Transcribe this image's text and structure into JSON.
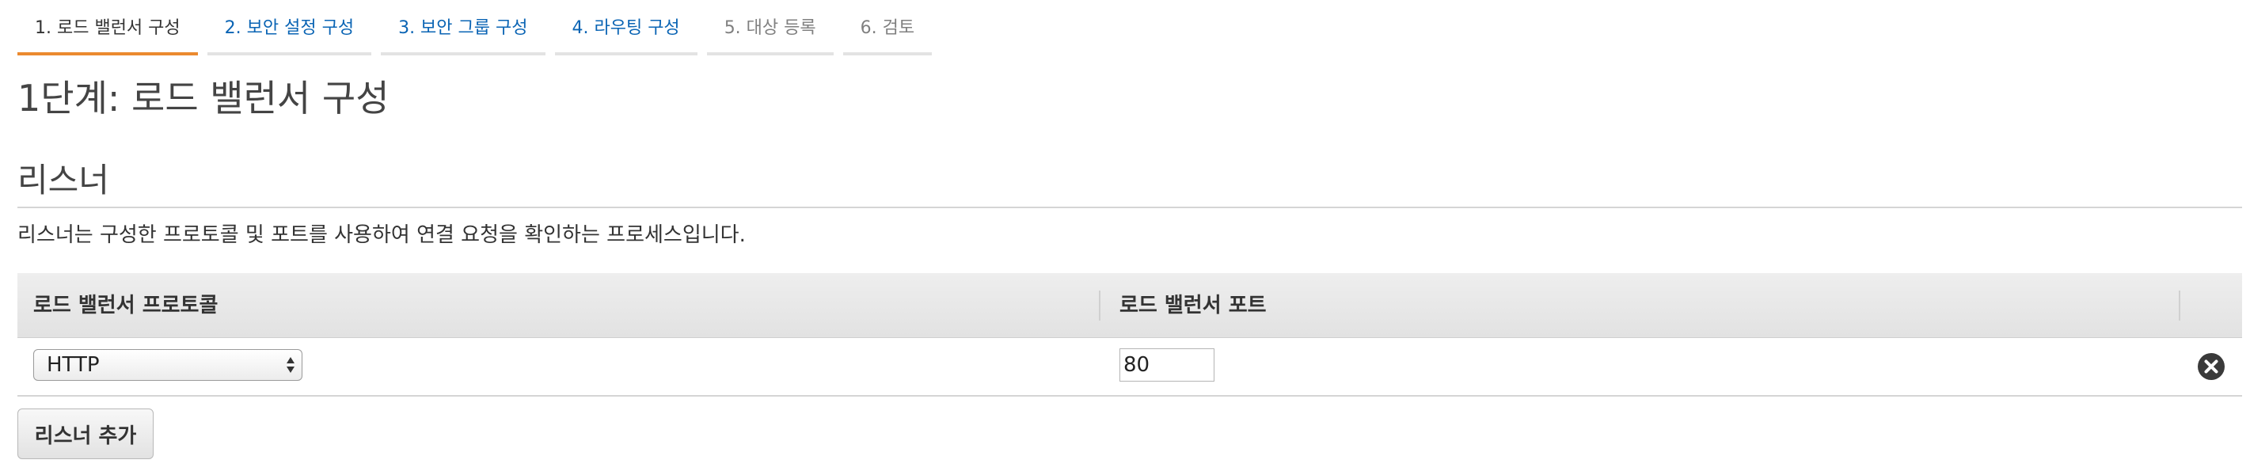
{
  "tabs": [
    {
      "label": "1. 로드 밸런서 구성",
      "state": "active"
    },
    {
      "label": "2. 보안 설정 구성",
      "state": "link"
    },
    {
      "label": "3. 보안 그룹 구성",
      "state": "link"
    },
    {
      "label": "4. 라우팅 구성",
      "state": "link"
    },
    {
      "label": "5. 대상 등록",
      "state": "disabled"
    },
    {
      "label": "6. 검토",
      "state": "disabled"
    }
  ],
  "page_title": "1단계: 로드 밸런서 구성",
  "listeners": {
    "title": "리스너",
    "description": "리스너는 구성한 프로토콜 및 포트를 사용하여 연결 요청을 확인하는 프로세스입니다.",
    "columns": {
      "protocol": "로드 밸런서 프로토콜",
      "port": "로드 밸런서 포트"
    },
    "rows": [
      {
        "protocol": "HTTP",
        "port": "80",
        "remove_icon": "close-circle-icon"
      }
    ],
    "add_button": "리스너 추가"
  },
  "colors": {
    "active_tab_underline": "#eb8a2f",
    "link_blue": "#0a64b4",
    "disabled_gray": "#808080"
  }
}
